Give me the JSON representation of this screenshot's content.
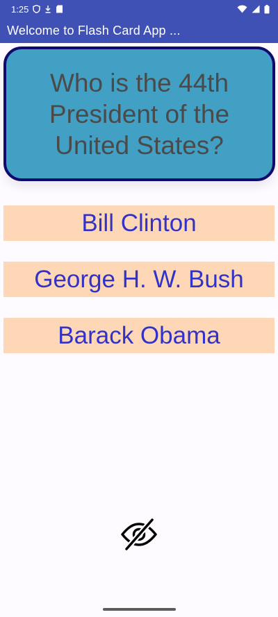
{
  "status_bar": {
    "time": "1:25",
    "icons_left": [
      "shield-icon",
      "download-icon",
      "sd-card-icon"
    ],
    "icons_right": [
      "wifi-icon",
      "signal-icon",
      "battery-icon"
    ]
  },
  "app_bar": {
    "title": "Welcome to Flash Card App ..."
  },
  "question": {
    "text": "Who is the 44th President of the United States?"
  },
  "answers": [
    {
      "label": "Bill Clinton"
    },
    {
      "label": "George H. W. Bush"
    },
    {
      "label": "Barack Obama"
    }
  ],
  "toggle": {
    "icon": "eye-off-icon"
  },
  "colors": {
    "app_bar": "#3f51b5",
    "card_fill": "#42a0c5",
    "card_border": "#0d0b6e",
    "answer_bg": "#fed8b6",
    "answer_text": "#3232c8"
  }
}
